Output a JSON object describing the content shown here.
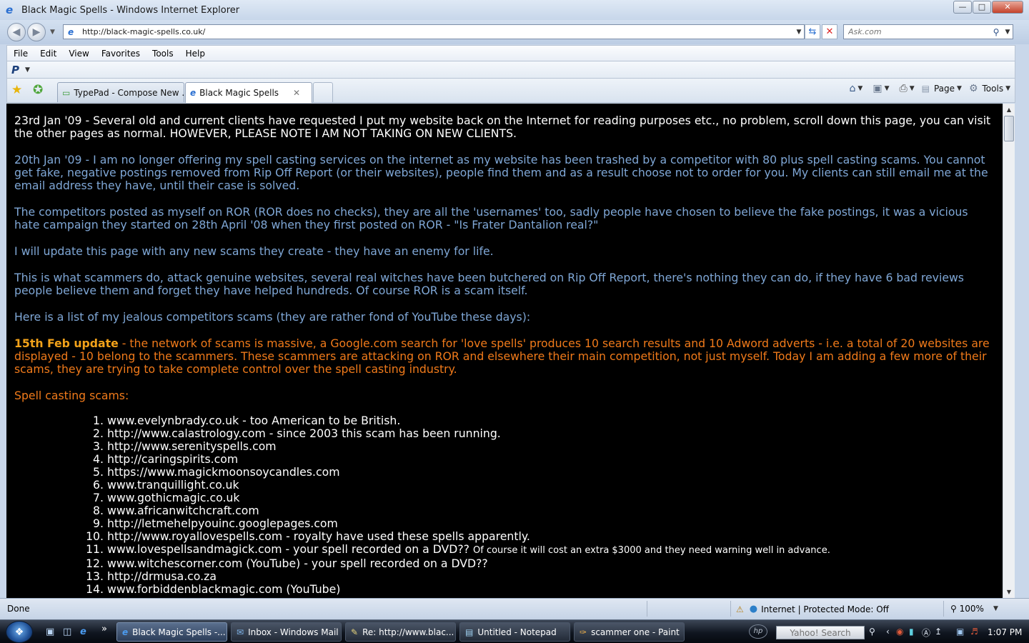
{
  "window": {
    "title": "Black Magic Spells - Windows Internet Explorer"
  },
  "address": {
    "url": "http://black-magic-spells.co.uk/"
  },
  "search": {
    "placeholder": "Ask.com"
  },
  "menu": [
    "File",
    "Edit",
    "View",
    "Favorites",
    "Tools",
    "Help"
  ],
  "tabs": [
    {
      "label": "TypePad - Compose New ...",
      "active": false
    },
    {
      "label": "Black Magic Spells",
      "active": true
    }
  ],
  "commandbar": {
    "page_label": "Page",
    "tools_label": "Tools"
  },
  "content": {
    "para1": "23rd Jan '09 - Several old and current clients have requested I put my website back on the Internet for reading purposes etc., no problem, scroll down this page, you can visit the other pages as normal. HOWEVER, PLEASE NOTE I AM NOT TAKING ON NEW CLIENTS.",
    "para2": "20th Jan '09 - I am no longer offering my spell casting services on the internet as my website has been trashed by a competitor with 80 plus spell casting scams. You cannot get fake, negative postings removed from Rip Off Report (or their websites), people find them and as a result choose not to order for you. My clients can still email me at the email address they have, until their case is solved.",
    "para3": "The competitors posted as myself on ROR (ROR does no checks), they are all the 'usernames' too, sadly people have chosen to believe the fake postings, it was a vicious hate campaign they started on 28th April '08 when they first posted on ROR - \"Is Frater Dantalion real?\"",
    "para4": "I will update this page with any new scams they create - they have an enemy for life.",
    "para5": "This is what scammers do, attack genuine websites, several real witches have been butchered on Rip Off Report, there's nothing they can do, if they have 6 bad reviews people believe them and forget they have helped hundreds. Of course ROR is a scam itself.",
    "para6": "Here is a list of my jealous competitors scams (they are rather fond of YouTube these days):",
    "update_bold": "15th Feb update",
    "update_text": " - the network of scams is massive, a Google.com search for 'love spells' produces 10 search results and 10 Adword adverts - i.e. a total of 20 websites are displayed - 10 belong to the scammers. These scammers are attacking on ROR and elsewhere their main competition, not just myself. Today I am adding a few more of their scams, they are trying to take complete control over the spell casting industry.",
    "list_heading": "Spell casting scams:",
    "list": [
      {
        "text": "www.evelynbrady.co.uk - too American to be British.",
        "small": ""
      },
      {
        "text": "http://www.calastrology.com - since 2003 this scam has been running.",
        "small": ""
      },
      {
        "text": "http://www.serenityspells.com",
        "small": ""
      },
      {
        "text": "http://caringspirits.com",
        "small": ""
      },
      {
        "text": "https://www.magickmoonsoycandles.com",
        "small": ""
      },
      {
        "text": "www.tranquillight.co.uk",
        "small": ""
      },
      {
        "text": "www.gothicmagic.co.uk",
        "small": ""
      },
      {
        "text": "www.africanwitchcraft.com",
        "small": ""
      },
      {
        "text": "http://letmehelpyouinc.googlepages.com",
        "small": ""
      },
      {
        "text": "http://www.royallovespells.com - royalty have used these spells apparently.",
        "small": ""
      },
      {
        "text": "www.lovespellsandmagick.com - your spell recorded on a DVD?? ",
        "small": "Of course it will cost an extra $3000 and they need warning well in advance."
      },
      {
        "text": "www.witchescorner.com (YouTube) - your spell recorded on a DVD??",
        "small": ""
      },
      {
        "text": "http://drmusa.co.za",
        "small": ""
      },
      {
        "text": "www.forbiddenblackmagic.com (YouTube)",
        "small": ""
      }
    ]
  },
  "status": {
    "text": "Done",
    "zone": "Internet | Protected Mode: Off",
    "zoom": "100%"
  },
  "taskbar": {
    "items": [
      {
        "label": "Black Magic Spells -...",
        "active": true
      },
      {
        "label": "Inbox - Windows Mail",
        "active": false
      },
      {
        "label": "Re: http://www.blac...",
        "active": false
      },
      {
        "label": "Untitled - Notepad",
        "active": false
      },
      {
        "label": "scammer one - Paint",
        "active": false
      }
    ],
    "search_placeholder": "Yahoo! Search",
    "hp_label": "hp",
    "clock": "1:07 PM"
  }
}
